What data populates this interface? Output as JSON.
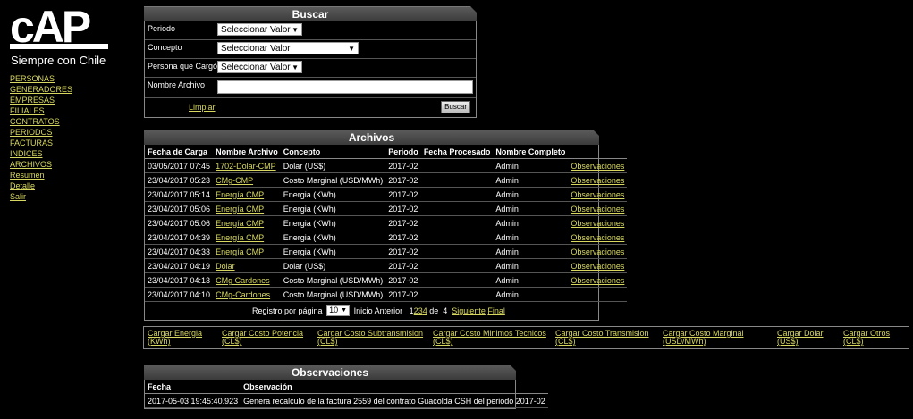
{
  "logo": {
    "text": "cAP",
    "tagline": "Siempre con Chile"
  },
  "nav": [
    "PERSONAS",
    "GENERADORES",
    "EMPRESAS",
    "FILIALES",
    "CONTRATOS",
    "PERIODOS",
    "FACTURAS",
    "INDICES",
    "ARCHIVOS",
    "Resumen",
    "Detalle",
    "Salir"
  ],
  "buscar": {
    "title": "Buscar",
    "periodo_label": "Periodo",
    "periodo_value": "Seleccionar Valor",
    "concepto_label": "Concepto",
    "concepto_value": "Seleccionar Valor",
    "persona_label": "Persona que Cargó",
    "persona_value": "Seleccionar Valor",
    "archivo_label": "Nombre Archivo",
    "archivo_value": "",
    "limpiar": "Limpiar",
    "buscar_btn": "Buscar"
  },
  "archivos": {
    "title": "Archivos",
    "columns": [
      "Fecha de Carga",
      "Nombre Archivo",
      "Concepto",
      "Periodo",
      "Fecha Procesado",
      "Nombre Completo",
      ""
    ],
    "rows": [
      {
        "fecha": "03/05/2017 07:45",
        "nombre": "1702-Dolar-CMP",
        "concepto": "Dolar (US$)",
        "periodo": "2017-02",
        "procesado": "",
        "completo": "Admin",
        "obs": "Observaciones"
      },
      {
        "fecha": "23/04/2017 05:23",
        "nombre": "CMg-CMP",
        "concepto": "Costo Marginal (USD/MWh)",
        "periodo": "2017-02",
        "procesado": "",
        "completo": "Admin",
        "obs": "Observaciones"
      },
      {
        "fecha": "23/04/2017 05:14",
        "nombre": "Energía CMP",
        "concepto": "Energia (KWh)",
        "periodo": "2017-02",
        "procesado": "",
        "completo": "Admin",
        "obs": "Observaciones"
      },
      {
        "fecha": "23/04/2017 05:06",
        "nombre": "Energía CMP",
        "concepto": "Energia (KWh)",
        "periodo": "2017-02",
        "procesado": "",
        "completo": "Admin",
        "obs": "Observaciones"
      },
      {
        "fecha": "23/04/2017 05:06",
        "nombre": "Energía CMP",
        "concepto": "Energia (KWh)",
        "periodo": "2017-02",
        "procesado": "",
        "completo": "Admin",
        "obs": "Observaciones"
      },
      {
        "fecha": "23/04/2017 04:39",
        "nombre": "Energía CMP",
        "concepto": "Energia (KWh)",
        "periodo": "2017-02",
        "procesado": "",
        "completo": "Admin",
        "obs": "Observaciones"
      },
      {
        "fecha": "23/04/2017 04:33",
        "nombre": "Energía CMP",
        "concepto": "Energia (KWh)",
        "periodo": "2017-02",
        "procesado": "",
        "completo": "Admin",
        "obs": "Observaciones"
      },
      {
        "fecha": "23/04/2017 04:19",
        "nombre": "Dolar",
        "concepto": "Dolar (US$)",
        "periodo": "2017-02",
        "procesado": "",
        "completo": "Admin",
        "obs": "Observaciones"
      },
      {
        "fecha": "23/04/2017 04:13",
        "nombre": "CMg Cardones",
        "concepto": "Costo Marginal (USD/MWh)",
        "periodo": "2017-02",
        "procesado": "",
        "completo": "Admin",
        "obs": "Observaciones"
      },
      {
        "fecha": "23/04/2017 04:10",
        "nombre": "CMg-Cardones",
        "concepto": "Costo Marginal (USD/MWh)",
        "periodo": "2017-02",
        "procesado": "",
        "completo": "Admin",
        "obs": ""
      }
    ],
    "pager": {
      "label": "Registro por página",
      "per_page": "10",
      "inicio": "Inicio",
      "anterior": "Anterior",
      "pages": [
        "1",
        "2",
        "3",
        "4"
      ],
      "de": "de",
      "total": "4",
      "siguiente": "Siguiente",
      "final": "Final"
    }
  },
  "cargar": [
    {
      "line1": "Cargar Energia",
      "line2": "(KWh)"
    },
    {
      "line1": "Cargar Costo Potencia",
      "line2": "(CL$)"
    },
    {
      "line1": "Cargar Costo Subtransmision",
      "line2": "(CL$)"
    },
    {
      "line1": "Cargar Costo Minimos Tecnicos",
      "line2": "(CL$)"
    },
    {
      "line1": "Cargar Costo Transmision",
      "line2": "(CL$)"
    },
    {
      "line1": "Cargar Costo Marginal",
      "line2": "(USD/MWh)"
    },
    {
      "line1": "Cargar Dolar",
      "line2": "(US$)"
    },
    {
      "line1": "Cargar Otros",
      "line2": "(CL$)"
    }
  ],
  "observaciones": {
    "title": "Observaciones",
    "columns": [
      "Fecha",
      "Observación"
    ],
    "rows": [
      {
        "fecha": "2017-05-03 19:45:40.923",
        "obs": "Genera recalculo de la factura 2559 del contrato Guacolda CSH del periodo 2017-02"
      }
    ]
  }
}
